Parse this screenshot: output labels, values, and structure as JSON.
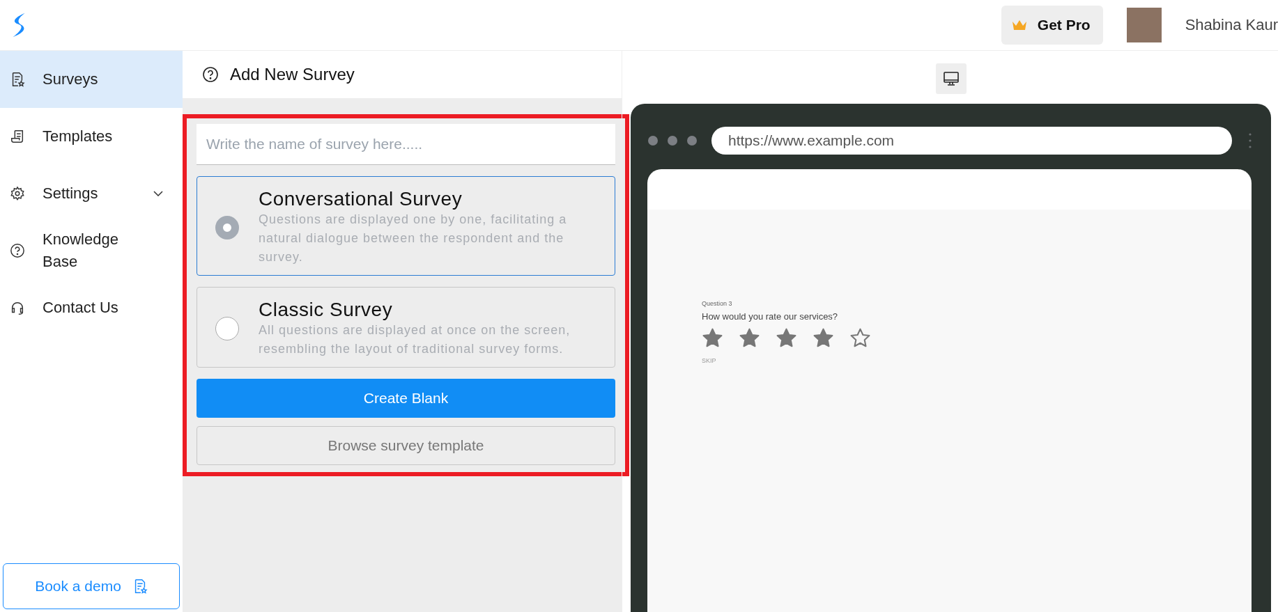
{
  "header": {
    "pro_button": "Get Pro",
    "user_name": "Shabina Kaur"
  },
  "sidebar": {
    "items": [
      {
        "label": "Surveys",
        "selected": true
      },
      {
        "label": "Templates",
        "selected": false
      },
      {
        "label": "Settings",
        "selected": false,
        "expanded": false
      },
      {
        "label": "Knowledge Base",
        "selected": false
      },
      {
        "label": "Contact Us",
        "selected": false
      }
    ],
    "demo_button": "Book a demo"
  },
  "panel": {
    "title": "Add New Survey",
    "name_field": {
      "placeholder": "Write the name of survey here....."
    },
    "options": [
      {
        "title": "Conversational Survey",
        "description": "Questions are displayed one by one, facilitating a natural dialogue between the respondent and the survey.",
        "selected": true
      },
      {
        "title": "Classic Survey",
        "description": "All questions are displayed at once on the screen, resembling the layout of traditional survey forms.",
        "selected": false
      }
    ],
    "primary_button": "Create Blank",
    "secondary_button": "Browse survey template"
  },
  "preview": {
    "url": "https://www.example.com",
    "question_label": "Question 3",
    "question": "How would you rate our services?",
    "stars": 4,
    "skip": "SKIP"
  }
}
